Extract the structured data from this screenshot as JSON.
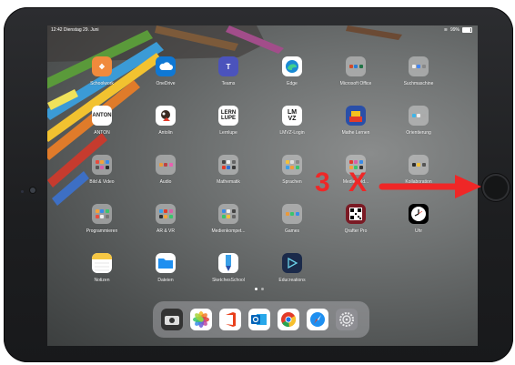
{
  "status": {
    "time": "12:42",
    "date": "Dienstag 29. Juni",
    "battery": "99%"
  },
  "apps": [
    {
      "label": "Schoolwork",
      "icon": "schoolwork-icon",
      "color": "#f08a3c"
    },
    {
      "label": "OneDrive",
      "icon": "onedrive-icon",
      "color": "#0f78d4"
    },
    {
      "label": "Teams",
      "icon": "teams-icon",
      "color": "#4b53bc"
    },
    {
      "label": "Edge",
      "icon": "edge-icon",
      "color": "#ffffff"
    },
    {
      "label": "Microsoft Office",
      "icon": "folder-icon",
      "color": "#d0d0d0"
    },
    {
      "label": "Suchmaschine",
      "icon": "folder-icon",
      "color": "#d0d0d0"
    },
    {
      "label": "ANTON",
      "icon": "anton-icon",
      "color": "#ffffff"
    },
    {
      "label": "Antolin",
      "icon": "antolin-icon",
      "color": "#ffffff"
    },
    {
      "label": "Lernlupe",
      "icon": "lernlupe-icon",
      "color": "#ffffff"
    },
    {
      "label": "LMVZ-Login",
      "icon": "lmvz-icon",
      "color": "#ffffff"
    },
    {
      "label": "Mathe Lernen",
      "icon": "mathe-lernen-icon",
      "color": "#2a4fa8"
    },
    {
      "label": "Orientierung",
      "icon": "folder-icon",
      "color": "#d0d0d0"
    },
    {
      "label": "Bild & Video",
      "icon": "folder-icon",
      "color": "#d0d0d0"
    },
    {
      "label": "Audio",
      "icon": "folder-icon",
      "color": "#d0d0d0"
    },
    {
      "label": "Mathematik",
      "icon": "folder-icon",
      "color": "#d0d0d0"
    },
    {
      "label": "Sprachen",
      "icon": "folder-icon",
      "color": "#d0d0d0"
    },
    {
      "label": "Medienbild...",
      "icon": "folder-icon",
      "color": "#d0d0d0"
    },
    {
      "label": "Kollaboration",
      "icon": "folder-icon",
      "color": "#d0d0d0"
    },
    {
      "label": "Programmieren",
      "icon": "folder-icon",
      "color": "#d0d0d0"
    },
    {
      "label": "AR & VR",
      "icon": "folder-icon",
      "color": "#d0d0d0"
    },
    {
      "label": "Medienkompet...",
      "icon": "folder-icon",
      "color": "#d0d0d0"
    },
    {
      "label": "Games",
      "icon": "folder-icon",
      "color": "#d0d0d0"
    },
    {
      "label": "Qrafter Pro",
      "icon": "qrafter-icon",
      "color": "#7a1a24"
    },
    {
      "label": "Uhr",
      "icon": "clock-icon",
      "color": "#000000"
    },
    {
      "label": "Notizen",
      "icon": "notes-icon",
      "color": "#ffffff"
    },
    {
      "label": "Dateien",
      "icon": "files-icon",
      "color": "#ffffff"
    },
    {
      "label": "SketchesSchool",
      "icon": "sketches-icon",
      "color": "#ffffff"
    },
    {
      "label": "Educreations",
      "icon": "educreations-icon",
      "color": "#1b2a4a"
    }
  ],
  "dock": [
    {
      "name": "camera-app",
      "icon": "camera-icon"
    },
    {
      "name": "photos-app",
      "icon": "photos-icon"
    },
    {
      "name": "office-app",
      "icon": "office-icon"
    },
    {
      "name": "outlook-app",
      "icon": "outlook-icon"
    },
    {
      "name": "chrome-app",
      "icon": "chrome-icon"
    },
    {
      "name": "safari-app",
      "icon": "safari-icon"
    },
    {
      "name": "settings-app",
      "icon": "settings-icon"
    }
  ],
  "annotation": {
    "text": "3 X",
    "color": "#ef2727"
  }
}
